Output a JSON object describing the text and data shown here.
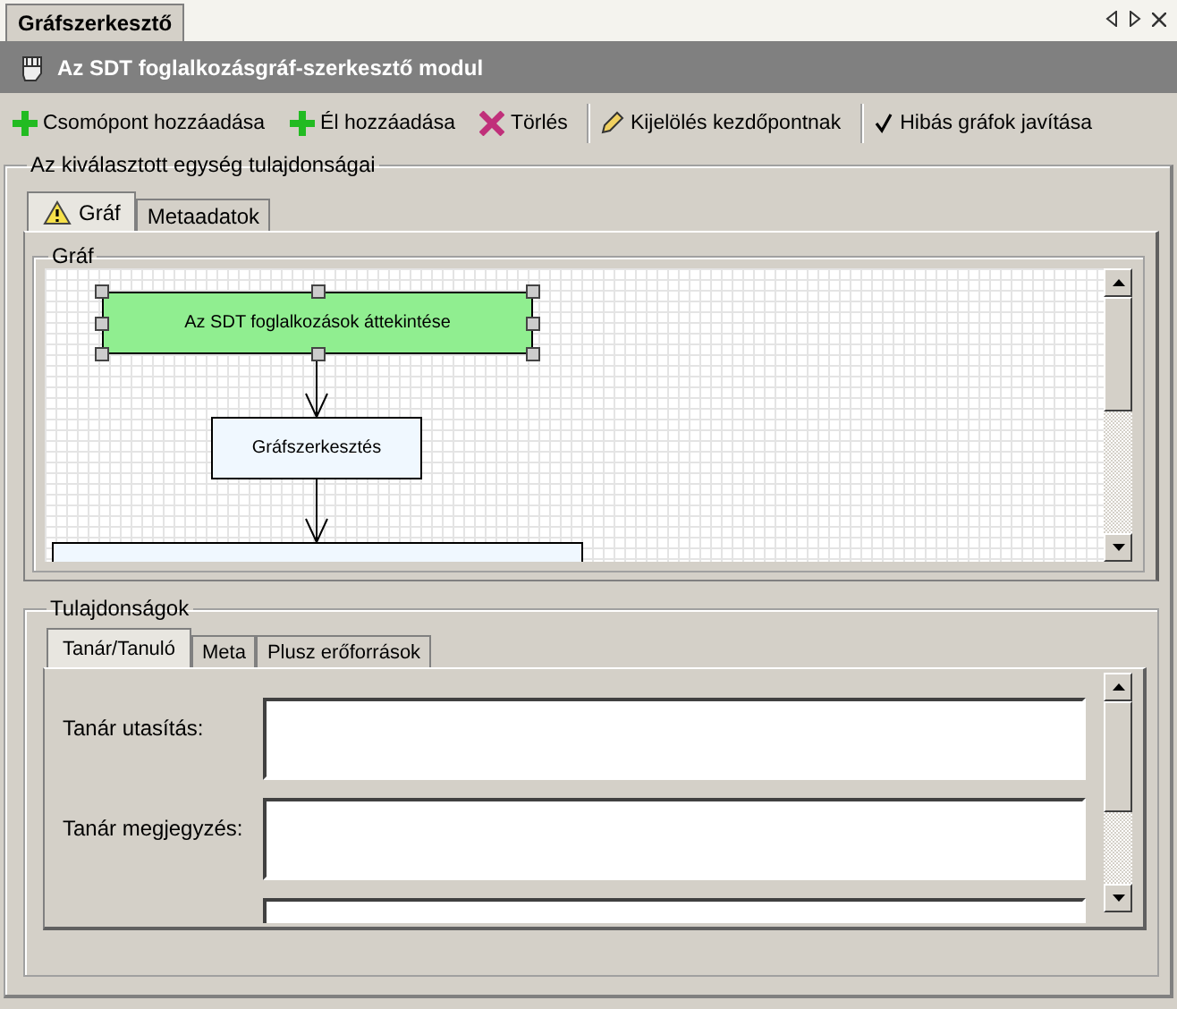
{
  "doc_tab": {
    "label": "Gráfszerkesztő",
    "selected": true
  },
  "module_title": "Az SDT foglalkozásgráf-szerkesztő modul",
  "toolbar": [
    {
      "kind": "plus",
      "label": "Csomópont hozzáadása"
    },
    {
      "kind": "plus",
      "label": "Él hozzáadása"
    },
    {
      "kind": "cross",
      "label": "Törlés"
    },
    {
      "kind": "pencil",
      "label": "Kijelölés kezdőpontnak"
    },
    {
      "kind": "check",
      "label": "Hibás gráfok javítása"
    }
  ],
  "properties_group": {
    "title": "Az kiválasztott egység tulajdonságai",
    "tabs": [
      {
        "label": "Gráf",
        "selected": true,
        "warning": true
      },
      {
        "label": "Metaadatok",
        "selected": false,
        "warning": false
      }
    ],
    "graph": {
      "title": "Gráf",
      "nodes": [
        {
          "label": "Az SDT foglalkozások áttekintése",
          "selected": true
        },
        {
          "label": "Gráfszerkesztés",
          "selected": false
        },
        {
          "selected": false
        }
      ]
    },
    "details": {
      "title": "Tulajdonságok",
      "tabs": [
        {
          "label": "Tanár/Tanuló",
          "selected": true
        },
        {
          "label": "Meta",
          "selected": false
        },
        {
          "label": "Plusz erőforrások",
          "selected": false
        }
      ],
      "fields": [
        {
          "label": "Tanár utasítás:"
        },
        {
          "label": "Tanár megjegyzés:"
        }
      ],
      "more_field_below": true
    }
  }
}
